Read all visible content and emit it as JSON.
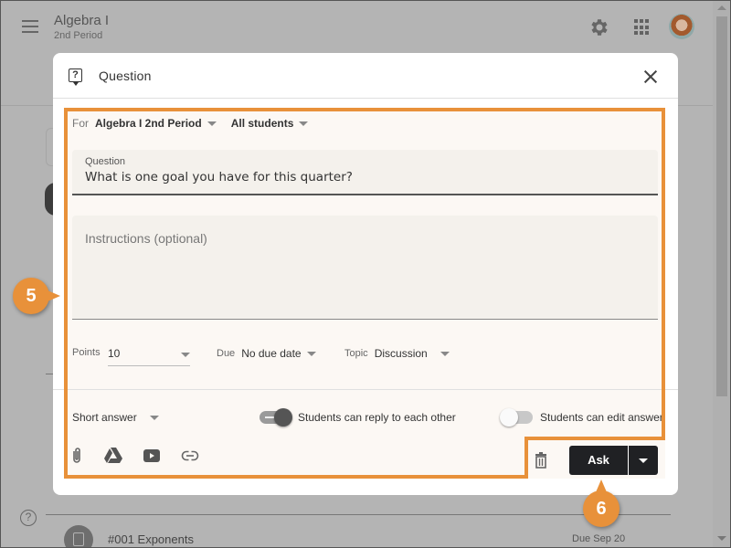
{
  "app": {
    "title": "Algebra I",
    "subtitle": "2nd Period",
    "icons": [
      "menu-icon",
      "gear-icon",
      "apps-icon",
      "avatar"
    ]
  },
  "background": {
    "help_icon_glyph": "?",
    "assignment": {
      "title": "#001 Exponents",
      "due": "Due Sep 20",
      "icon": "clipboard-icon"
    }
  },
  "dialog": {
    "title": "Question",
    "icon": "question-icon",
    "close_icon": "close-icon",
    "for_label": "For",
    "class_select": "Algebra I 2nd Period",
    "students_select": "All students",
    "question_label": "Question",
    "question_value": "What is one goal you have for this quarter?",
    "instructions_placeholder": "Instructions (optional)",
    "points_label": "Points",
    "points_value": "10",
    "due_label": "Due",
    "due_value": "No due date",
    "topic_label": "Topic",
    "topic_value": "Discussion",
    "answer_type": "Short answer",
    "toggles": [
      {
        "label": "Students can reply to each other",
        "on": true
      },
      {
        "label": "Students can edit answer",
        "on": false
      }
    ],
    "attachments": [
      "paperclip-icon",
      "google-drive-icon",
      "youtube-icon",
      "link-icon"
    ],
    "delete_icon": "trash-icon",
    "ask_label": "Ask"
  },
  "callouts": {
    "step5": "5",
    "step6": "6",
    "color": "#e8913a"
  }
}
